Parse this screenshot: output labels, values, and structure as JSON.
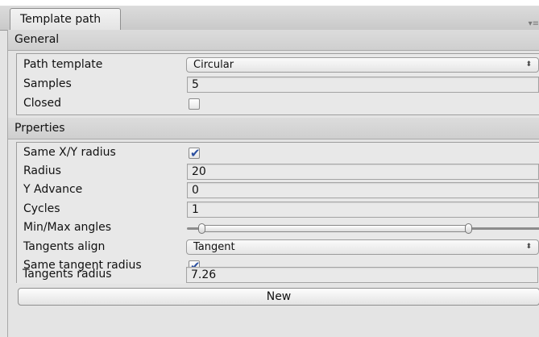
{
  "tab": {
    "title": "Template path",
    "menu_icon": "▾≡"
  },
  "general": {
    "header": "General",
    "path_template": {
      "label": "Path template",
      "value": "Circular"
    },
    "samples": {
      "label": "Samples",
      "value": "5"
    },
    "closed": {
      "label": "Closed",
      "checked": false
    }
  },
  "properties": {
    "header": "Prperties",
    "same_xy_radius": {
      "label": "Same X/Y radius",
      "checked": true
    },
    "radius": {
      "label": "Radius",
      "value": "20"
    },
    "y_advance": {
      "label": "Y Advance",
      "value": "0"
    },
    "cycles": {
      "label": "Cycles",
      "value": "1"
    },
    "min_max_angles": {
      "label": "Min/Max angles"
    },
    "tangents_align": {
      "label": "Tangents align",
      "value": "Tangent"
    },
    "same_tangent_radius": {
      "label": "Same tangent radius",
      "checked": true
    },
    "tangents_radius": {
      "label": "Tangents radius",
      "value": "7.26"
    }
  },
  "new_button": {
    "label": "New"
  },
  "icons": {
    "check": "✔",
    "dropdown_arrows": "⬍"
  }
}
